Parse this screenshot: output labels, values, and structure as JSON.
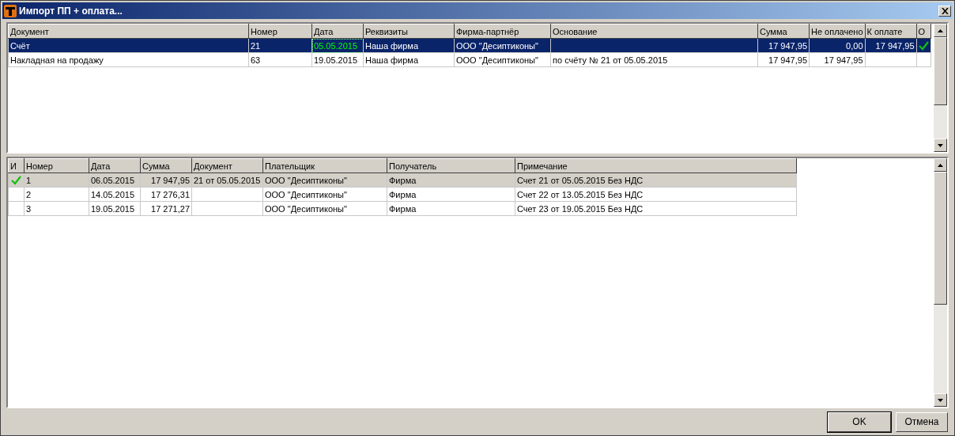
{
  "window": {
    "title": "Импорт ПП + оплата..."
  },
  "documents": {
    "columns": [
      "Документ",
      "Номер",
      "Дата",
      "Реквизиты",
      "Фирма-партнёр",
      "Основание",
      "Сумма",
      "Не оплачено",
      "К оплате",
      "О"
    ],
    "rows": [
      {
        "selected": true,
        "date_focused": true,
        "paid": true,
        "cells": [
          "Счёт",
          "21",
          "05.05.2015",
          "Наша фирма",
          "ООО \"Десиптиконы\"",
          null,
          "17 947,95",
          "0,00",
          "17 947,95"
        ]
      },
      {
        "selected": false,
        "date_focused": false,
        "paid": false,
        "cells": [
          "Накладная на продажу",
          "63",
          "19.05.2015",
          "Наша фирма",
          "ООО \"Десиптиконы\"",
          "по счёту № 21 от 05.05.2015",
          "17 947,95",
          "17 947,95",
          null
        ]
      }
    ]
  },
  "payments": {
    "columns": [
      "И",
      "Номер",
      "Дата",
      "Сумма",
      "Документ",
      "Плательщик",
      "Получатель",
      "Примечание"
    ],
    "rows": [
      {
        "selected": true,
        "imported": true,
        "cells": [
          null,
          "1",
          "06.05.2015",
          "17 947,95",
          "21 от 05.05.2015",
          "ООО \"Десиптиконы\"",
          "Фирма",
          "Счет 21 от 05.05.2015 Без НДС"
        ]
      },
      {
        "selected": false,
        "imported": false,
        "cells": [
          null,
          "2",
          "14.05.2015",
          "17 276,31",
          null,
          "ООО \"Десиптиконы\"",
          "Фирма",
          "Счет 22 от 13.05.2015 Без НДС"
        ]
      },
      {
        "selected": false,
        "imported": false,
        "cells": [
          null,
          "3",
          "19.05.2015",
          "17 271,27",
          null,
          "ООО \"Десиптиконы\"",
          "Фирма",
          "Счет 23 от 19.05.2015 Без НДС"
        ]
      }
    ]
  },
  "buttons": [
    "OK",
    "Отмена"
  ]
}
